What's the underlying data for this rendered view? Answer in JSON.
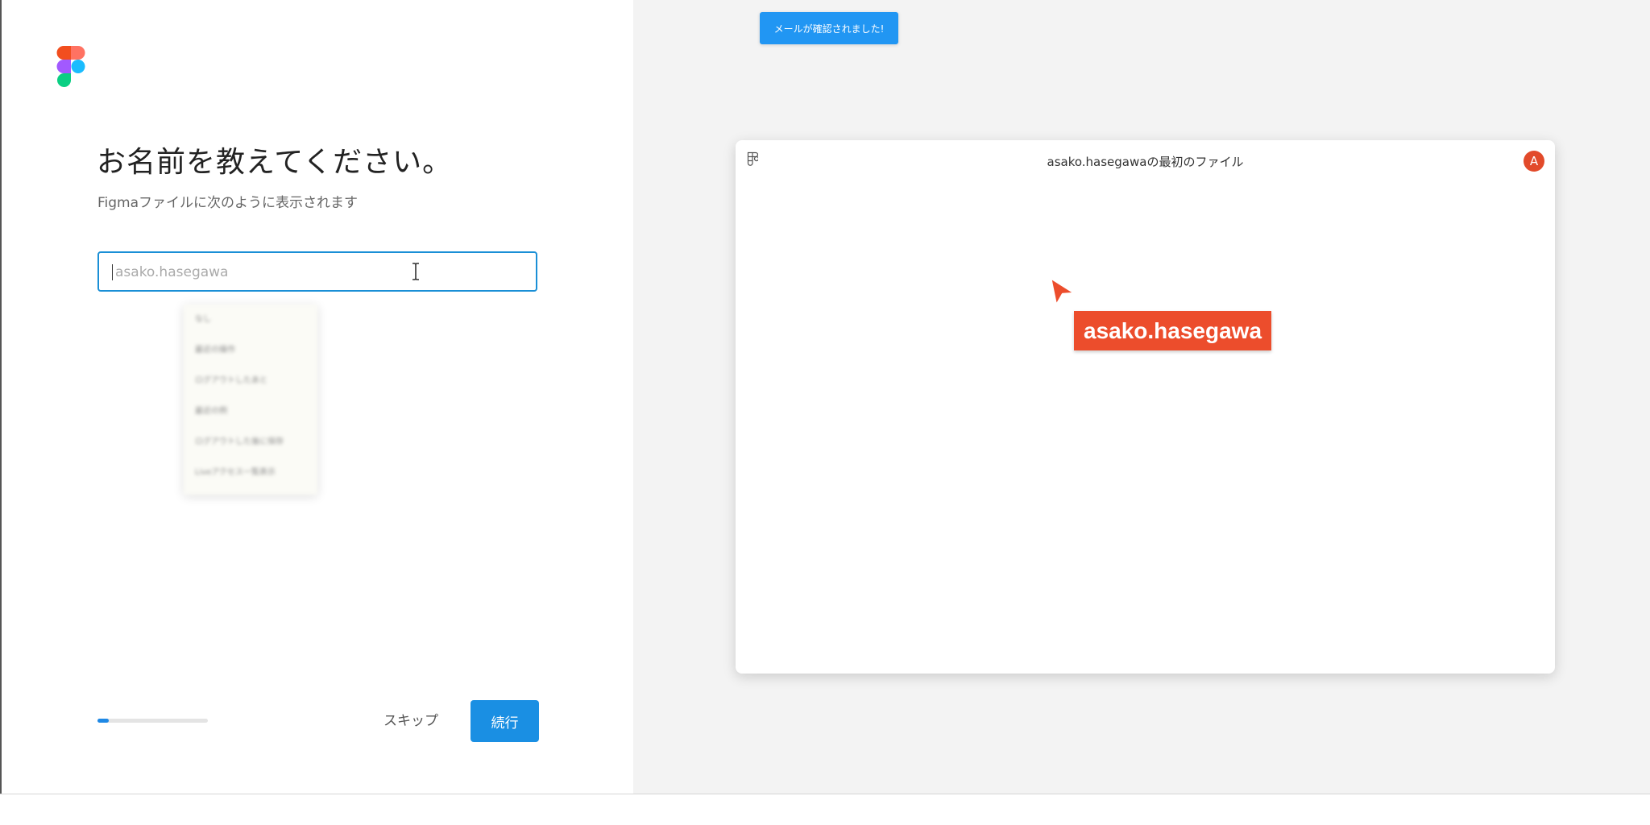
{
  "onboarding": {
    "heading": "お名前を教えてください。",
    "subheading": "Figmaファイルに次のように表示されます",
    "name_input": {
      "placeholder": "asako.hasegawa",
      "value": ""
    },
    "dropdown_items": [
      "なし",
      "最近の操作",
      "ログアウトしたあと",
      "最近の例",
      "ログアウトした後に保存",
      "Liveアクセス一覧表示"
    ],
    "progress_fraction": 0.1,
    "skip_label": "スキップ",
    "continue_label": "続行"
  },
  "toast": {
    "message": "メールが確認されました!"
  },
  "preview": {
    "file_title": "asako.hasegawaの最初のファイル",
    "avatar_initial": "A",
    "cursor_name": "asako.hasegawa"
  },
  "colors": {
    "accent": "#1a8fe3",
    "cursor_tag": "#ec4d2c",
    "avatar": "#e24a2a"
  },
  "icons": [
    "figma-logo-icon",
    "ibeam-cursor-icon",
    "figma-mini-logo-icon",
    "pointer-cursor-icon"
  ]
}
